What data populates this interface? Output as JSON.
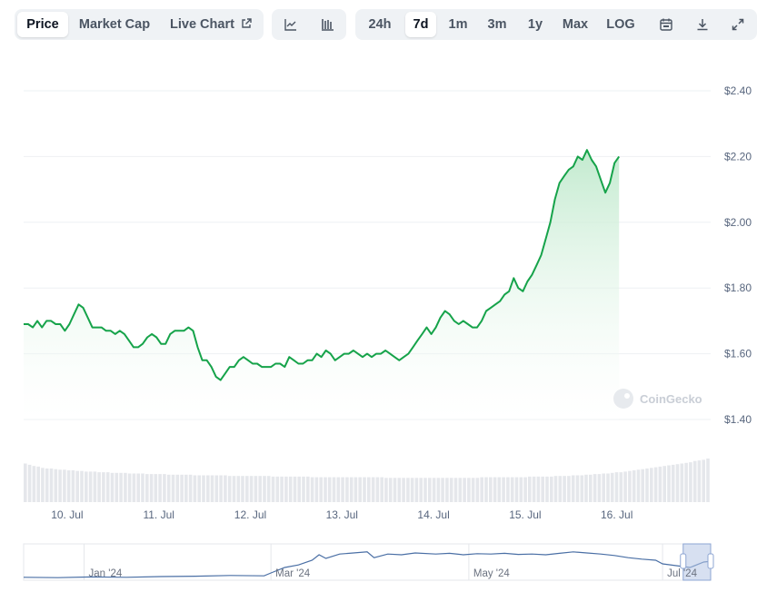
{
  "toolbar": {
    "metric_tabs": [
      "Price",
      "Market Cap",
      "Live Chart"
    ],
    "active_metric": "Price",
    "range_tabs": [
      "24h",
      "7d",
      "1m",
      "3m",
      "1y",
      "Max",
      "LOG"
    ],
    "active_range": "7d",
    "icons": [
      "line-chart-icon",
      "candlestick-icon",
      "calendar-icon",
      "download-icon",
      "expand-icon",
      "external-link-icon"
    ]
  },
  "colors": {
    "line": "#16a34a",
    "area_top": "#bfe9cc",
    "volume": "#e5e7eb",
    "navigator_line": "#4a6fa5",
    "navigator_selection": "#b7c7e6"
  },
  "watermark": "CoinGecko",
  "chart_data": {
    "type": "area",
    "y_ticks": [
      "$2.40",
      "$2.20",
      "$2.00",
      "$1.80",
      "$1.60",
      "$1.40"
    ],
    "ylim": [
      1.4,
      2.4
    ],
    "x_ticks": [
      "10. Jul",
      "11. Jul",
      "12. Jul",
      "13. Jul",
      "14. Jul",
      "15. Jul",
      "16. Jul"
    ],
    "x_tick_values": [
      9.475,
      10.475,
      11.475,
      12.475,
      13.475,
      14.475,
      15.475
    ],
    "xlim": [
      9.0,
      16.5
    ],
    "grid": true,
    "series": [
      {
        "values": [
          [
            9.0,
            1.69
          ],
          [
            9.05,
            1.69
          ],
          [
            9.1,
            1.68
          ],
          [
            9.15,
            1.7
          ],
          [
            9.2,
            1.68
          ],
          [
            9.25,
            1.7
          ],
          [
            9.3,
            1.7
          ],
          [
            9.35,
            1.69
          ],
          [
            9.4,
            1.69
          ],
          [
            9.45,
            1.67
          ],
          [
            9.5,
            1.69
          ],
          [
            9.55,
            1.72
          ],
          [
            9.6,
            1.75
          ],
          [
            9.65,
            1.74
          ],
          [
            9.7,
            1.71
          ],
          [
            9.75,
            1.68
          ],
          [
            9.8,
            1.68
          ],
          [
            9.85,
            1.68
          ],
          [
            9.9,
            1.67
          ],
          [
            9.95,
            1.67
          ],
          [
            10.0,
            1.66
          ],
          [
            10.05,
            1.67
          ],
          [
            10.1,
            1.66
          ],
          [
            10.15,
            1.64
          ],
          [
            10.2,
            1.62
          ],
          [
            10.25,
            1.62
          ],
          [
            10.3,
            1.63
          ],
          [
            10.35,
            1.65
          ],
          [
            10.4,
            1.66
          ],
          [
            10.45,
            1.65
          ],
          [
            10.5,
            1.63
          ],
          [
            10.55,
            1.63
          ],
          [
            10.6,
            1.66
          ],
          [
            10.65,
            1.67
          ],
          [
            10.7,
            1.67
          ],
          [
            10.75,
            1.67
          ],
          [
            10.8,
            1.68
          ],
          [
            10.85,
            1.67
          ],
          [
            10.9,
            1.62
          ],
          [
            10.95,
            1.58
          ],
          [
            11.0,
            1.58
          ],
          [
            11.05,
            1.56
          ],
          [
            11.1,
            1.53
          ],
          [
            11.15,
            1.52
          ],
          [
            11.2,
            1.54
          ],
          [
            11.25,
            1.56
          ],
          [
            11.3,
            1.56
          ],
          [
            11.35,
            1.58
          ],
          [
            11.4,
            1.59
          ],
          [
            11.45,
            1.58
          ],
          [
            11.5,
            1.57
          ],
          [
            11.55,
            1.57
          ],
          [
            11.6,
            1.56
          ],
          [
            11.65,
            1.56
          ],
          [
            11.7,
            1.56
          ],
          [
            11.75,
            1.57
          ],
          [
            11.8,
            1.57
          ],
          [
            11.85,
            1.56
          ],
          [
            11.9,
            1.59
          ],
          [
            11.95,
            1.58
          ],
          [
            12.0,
            1.57
          ],
          [
            12.05,
            1.57
          ],
          [
            12.1,
            1.58
          ],
          [
            12.15,
            1.58
          ],
          [
            12.2,
            1.6
          ],
          [
            12.25,
            1.59
          ],
          [
            12.3,
            1.61
          ],
          [
            12.35,
            1.6
          ],
          [
            12.4,
            1.58
          ],
          [
            12.45,
            1.59
          ],
          [
            12.5,
            1.6
          ],
          [
            12.55,
            1.6
          ],
          [
            12.6,
            1.61
          ],
          [
            12.65,
            1.6
          ],
          [
            12.7,
            1.59
          ],
          [
            12.75,
            1.6
          ],
          [
            12.8,
            1.59
          ],
          [
            12.85,
            1.6
          ],
          [
            12.9,
            1.6
          ],
          [
            12.95,
            1.61
          ],
          [
            13.0,
            1.6
          ],
          [
            13.05,
            1.59
          ],
          [
            13.1,
            1.58
          ],
          [
            13.15,
            1.59
          ],
          [
            13.2,
            1.6
          ],
          [
            13.25,
            1.62
          ],
          [
            13.3,
            1.64
          ],
          [
            13.35,
            1.66
          ],
          [
            13.4,
            1.68
          ],
          [
            13.45,
            1.66
          ],
          [
            13.5,
            1.68
          ],
          [
            13.55,
            1.71
          ],
          [
            13.6,
            1.73
          ],
          [
            13.65,
            1.72
          ],
          [
            13.7,
            1.7
          ],
          [
            13.75,
            1.69
          ],
          [
            13.8,
            1.7
          ],
          [
            13.85,
            1.69
          ],
          [
            13.9,
            1.68
          ],
          [
            13.95,
            1.68
          ],
          [
            14.0,
            1.7
          ],
          [
            14.05,
            1.73
          ],
          [
            14.1,
            1.74
          ],
          [
            14.15,
            1.75
          ],
          [
            14.2,
            1.76
          ],
          [
            14.25,
            1.78
          ],
          [
            14.3,
            1.79
          ],
          [
            14.35,
            1.83
          ],
          [
            14.4,
            1.8
          ],
          [
            14.45,
            1.79
          ],
          [
            14.5,
            1.82
          ],
          [
            14.55,
            1.84
          ],
          [
            14.6,
            1.87
          ],
          [
            14.65,
            1.9
          ],
          [
            14.7,
            1.95
          ],
          [
            14.75,
            2.0
          ],
          [
            14.8,
            2.07
          ],
          [
            14.85,
            2.12
          ],
          [
            14.9,
            2.14
          ],
          [
            14.95,
            2.16
          ],
          [
            15.0,
            2.17
          ],
          [
            15.05,
            2.2
          ],
          [
            15.1,
            2.19
          ],
          [
            15.15,
            2.22
          ],
          [
            15.2,
            2.19
          ],
          [
            15.25,
            2.17
          ],
          [
            15.3,
            2.13
          ],
          [
            15.35,
            2.09
          ],
          [
            15.4,
            2.12
          ],
          [
            15.45,
            2.18
          ],
          [
            15.5,
            2.2
          ]
        ]
      }
    ],
    "volume_relative": [
      0.62,
      0.6,
      0.58,
      0.57,
      0.55,
      0.54,
      0.54,
      0.53,
      0.52,
      0.52,
      0.51,
      0.51,
      0.5,
      0.5,
      0.49,
      0.49,
      0.49,
      0.48,
      0.48,
      0.48,
      0.47,
      0.47,
      0.47,
      0.47,
      0.46,
      0.46,
      0.46,
      0.46,
      0.45,
      0.45,
      0.45,
      0.45,
      0.45,
      0.44,
      0.44,
      0.44,
      0.44,
      0.44,
      0.44,
      0.43,
      0.43,
      0.43,
      0.43,
      0.43,
      0.43,
      0.43,
      0.43,
      0.42,
      0.42,
      0.42,
      0.42,
      0.42,
      0.42,
      0.42,
      0.42,
      0.42,
      0.42,
      0.41,
      0.41,
      0.41,
      0.41,
      0.41,
      0.41,
      0.41,
      0.41,
      0.41,
      0.4,
      0.4,
      0.4,
      0.4,
      0.4,
      0.4,
      0.4,
      0.4,
      0.4,
      0.4,
      0.4,
      0.4,
      0.4,
      0.4,
      0.4,
      0.4,
      0.4,
      0.39,
      0.39,
      0.39,
      0.39,
      0.39,
      0.39,
      0.39,
      0.39,
      0.39,
      0.39,
      0.39,
      0.39,
      0.39,
      0.39,
      0.39,
      0.39,
      0.39,
      0.39,
      0.39,
      0.39,
      0.39,
      0.39,
      0.4,
      0.4,
      0.4,
      0.4,
      0.4,
      0.4,
      0.4,
      0.4,
      0.4,
      0.4,
      0.4,
      0.41,
      0.41,
      0.41,
      0.41,
      0.41,
      0.41,
      0.42,
      0.42,
      0.42,
      0.42,
      0.43,
      0.43,
      0.43,
      0.44,
      0.44,
      0.45,
      0.45,
      0.46,
      0.46,
      0.47,
      0.48,
      0.48,
      0.49,
      0.5,
      0.51,
      0.52,
      0.53,
      0.54,
      0.55,
      0.56,
      0.57,
      0.58,
      0.59,
      0.6,
      0.61,
      0.62,
      0.63,
      0.64,
      0.66,
      0.67,
      0.68,
      0.7
    ],
    "navigator": {
      "labels": [
        "Jan '24",
        "Mar '24",
        "May '24",
        "Jul '24"
      ],
      "series": [
        [
          0,
          0.08
        ],
        [
          0.05,
          0.07
        ],
        [
          0.1,
          0.09
        ],
        [
          0.15,
          0.08
        ],
        [
          0.2,
          0.1
        ],
        [
          0.25,
          0.11
        ],
        [
          0.3,
          0.13
        ],
        [
          0.35,
          0.12
        ],
        [
          0.36,
          0.2
        ],
        [
          0.38,
          0.35
        ],
        [
          0.4,
          0.42
        ],
        [
          0.42,
          0.55
        ],
        [
          0.43,
          0.7
        ],
        [
          0.44,
          0.6
        ],
        [
          0.46,
          0.72
        ],
        [
          0.48,
          0.75
        ],
        [
          0.5,
          0.78
        ],
        [
          0.51,
          0.62
        ],
        [
          0.53,
          0.72
        ],
        [
          0.55,
          0.7
        ],
        [
          0.57,
          0.75
        ],
        [
          0.6,
          0.72
        ],
        [
          0.62,
          0.74
        ],
        [
          0.64,
          0.7
        ],
        [
          0.66,
          0.73
        ],
        [
          0.68,
          0.72
        ],
        [
          0.7,
          0.74
        ],
        [
          0.72,
          0.71
        ],
        [
          0.74,
          0.72
        ],
        [
          0.76,
          0.7
        ],
        [
          0.78,
          0.74
        ],
        [
          0.8,
          0.78
        ],
        [
          0.82,
          0.75
        ],
        [
          0.84,
          0.72
        ],
        [
          0.86,
          0.68
        ],
        [
          0.88,
          0.62
        ],
        [
          0.9,
          0.58
        ],
        [
          0.92,
          0.55
        ],
        [
          0.93,
          0.45
        ],
        [
          0.95,
          0.4
        ],
        [
          0.97,
          0.35
        ],
        [
          0.99,
          0.5
        ],
        [
          1.0,
          0.52
        ]
      ],
      "selection": [
        0.96,
        1.0
      ]
    }
  }
}
